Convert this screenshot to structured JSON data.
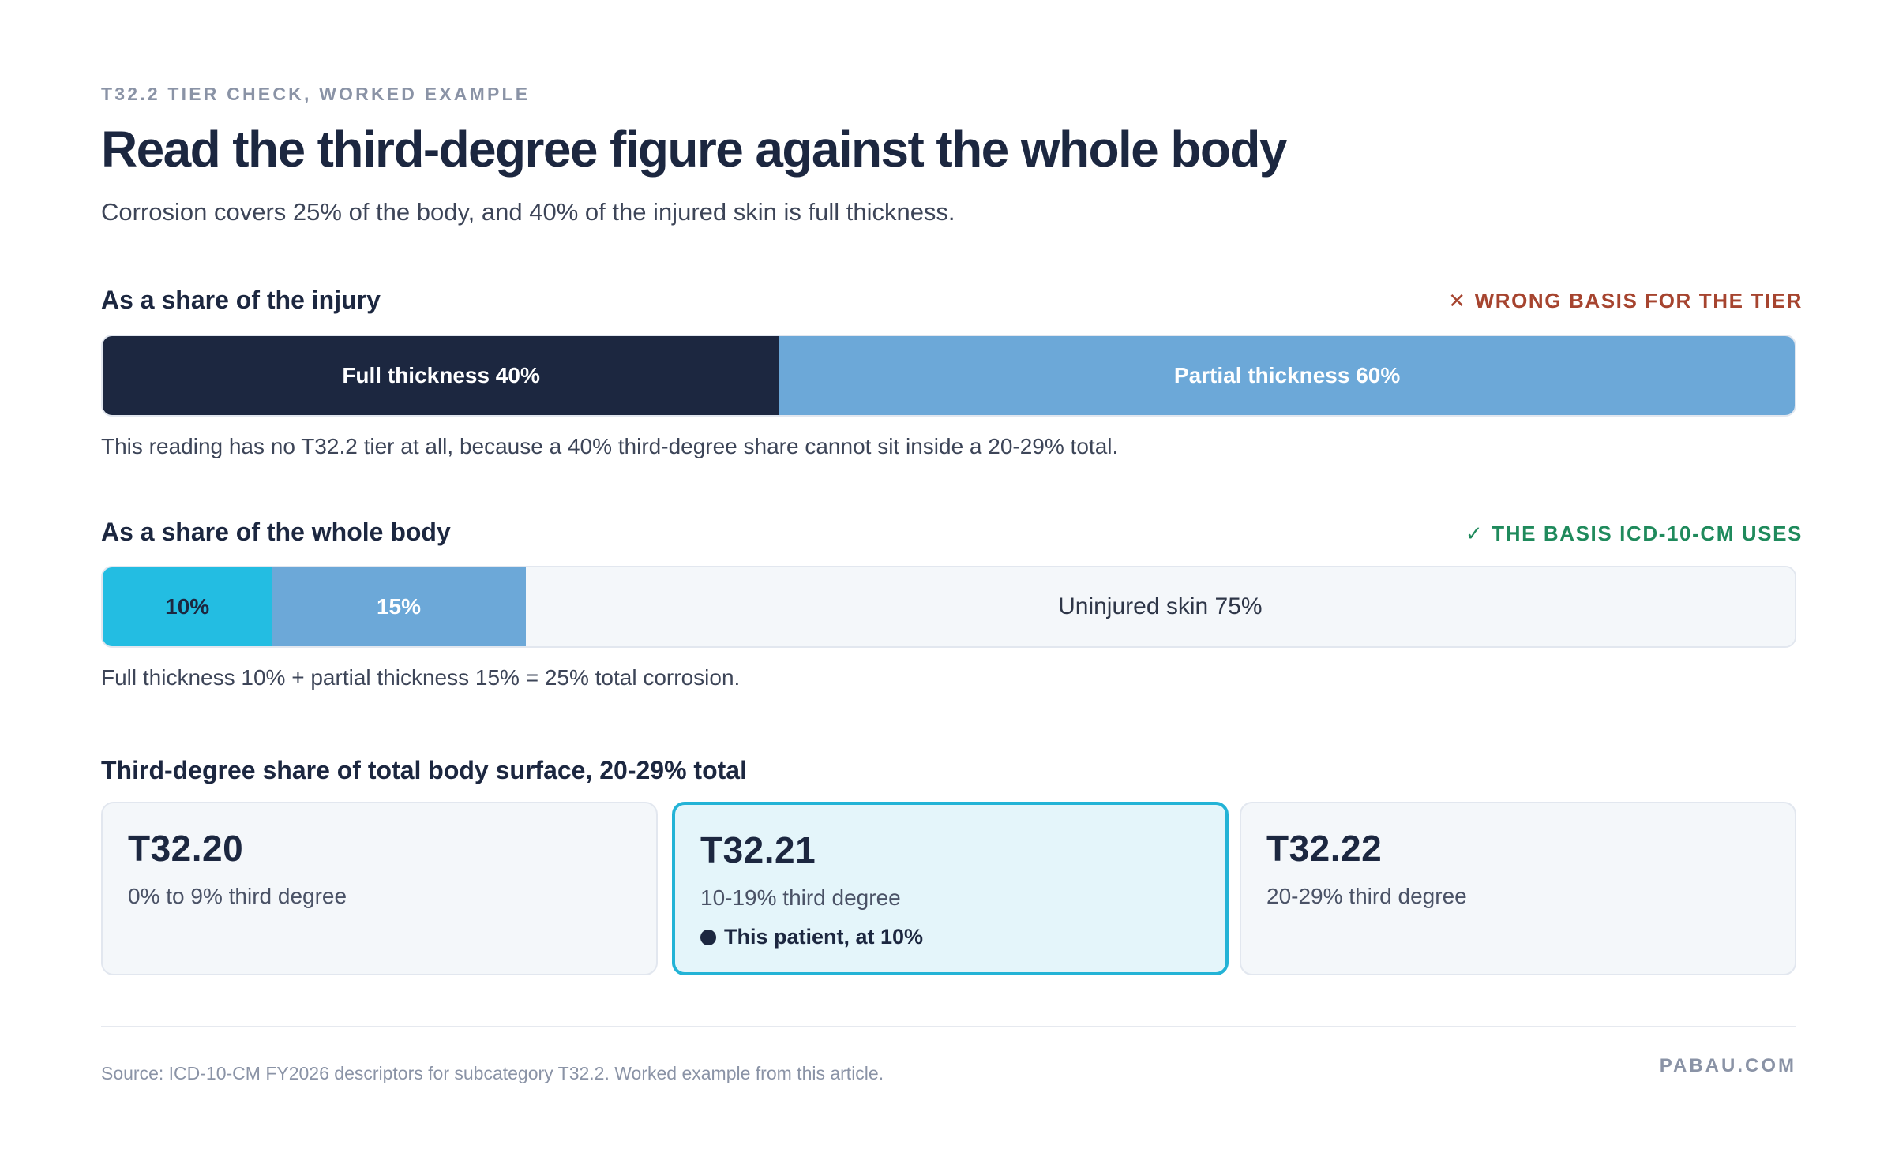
{
  "eyebrow": "T32.2 TIER CHECK, WORKED EXAMPLE",
  "headline": "Read the third-degree figure against the whole body",
  "subhead": "Corrosion covers 25% of the body, and 40% of the injured skin is full thickness.",
  "colors": {
    "ink": "#1c2740",
    "partial_blue": "#6ca8d8",
    "full_thickness_cyan": "#23bde2",
    "uninjured": "#f4f7fa",
    "wrong": "#a6442f",
    "right": "#1f8a5c",
    "highlight_border": "#23b3d6"
  },
  "injury_section": {
    "label": "As a share of the injury",
    "verdict_icon": "close-x-icon",
    "verdict_glyph": "✕",
    "verdict": "WRONG BASIS FOR THE TIER",
    "note": "This reading has no T32.2 tier at all, because a 40% third-degree share cannot sit inside a 20-29% total."
  },
  "body_section": {
    "label": "As a share of the whole body",
    "verdict_icon": "check-icon",
    "verdict_glyph": "✓",
    "verdict": "THE BASIS ICD-10-CM USES",
    "note": "Full thickness 10% + partial thickness 15% = 25% total corrosion."
  },
  "chart_data": [
    {
      "type": "bar",
      "stacked": true,
      "orientation": "horizontal",
      "title": "As a share of the injury",
      "unit": "%",
      "segments": [
        {
          "label": "Full thickness 40%",
          "value": 40,
          "color": "#1c2740"
        },
        {
          "label": "Partial thickness 60%",
          "value": 60,
          "color": "#6ca8d8"
        }
      ]
    },
    {
      "type": "bar",
      "stacked": true,
      "orientation": "horizontal",
      "title": "As a share of the whole body",
      "unit": "%",
      "segments": [
        {
          "label": "10%",
          "value": 10,
          "color": "#23bde2"
        },
        {
          "label": "15%",
          "value": 15,
          "color": "#6ca8d8"
        },
        {
          "label": "Uninjured skin 75%",
          "value": 75,
          "color": "#f4f7fa"
        }
      ]
    }
  ],
  "tiers": {
    "label": "Third-degree share of total body surface, 20-29% total",
    "cards": [
      {
        "code": "T32.20",
        "range": "0% to 9% third degree",
        "active": false
      },
      {
        "code": "T32.21",
        "range": "10-19% third degree",
        "active": true,
        "marker": "This patient, at 10%"
      },
      {
        "code": "T32.22",
        "range": "20-29% third degree",
        "active": false
      }
    ]
  },
  "footer": {
    "source": "Source: ICD-10-CM FY2026 descriptors for subcategory T32.2. Worked example from this article.",
    "brand": "PABAU.COM"
  }
}
